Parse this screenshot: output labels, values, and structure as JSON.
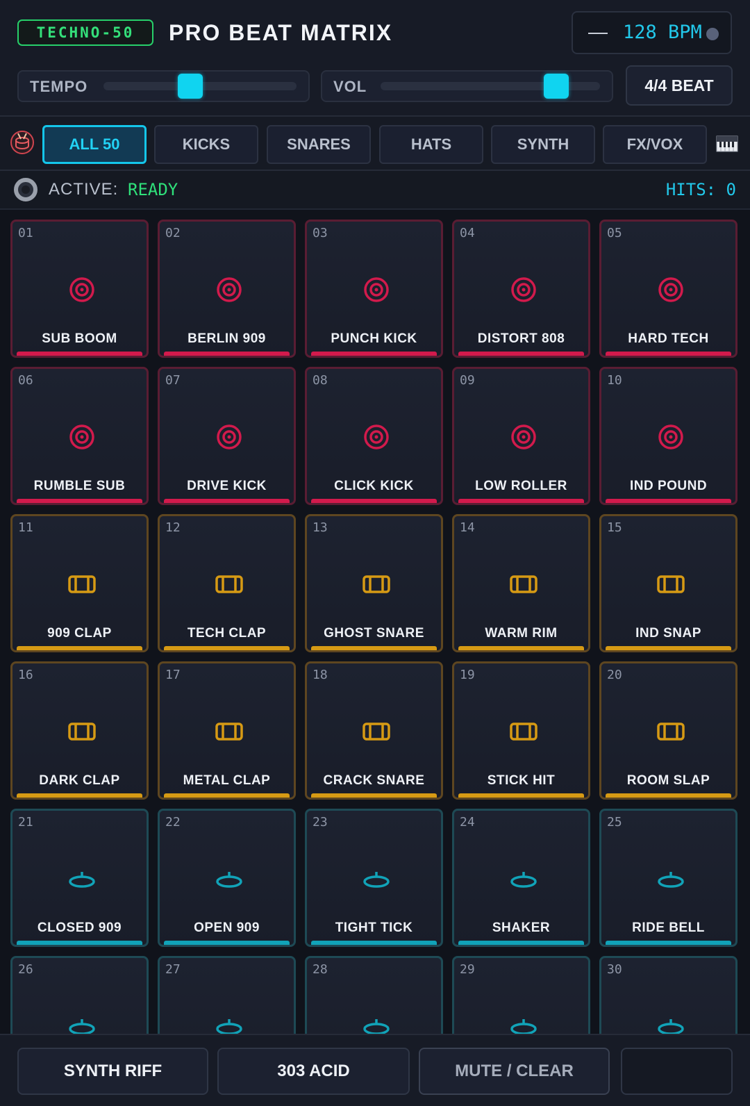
{
  "header": {
    "badge": "TECHNO-50",
    "title": "PRO BEAT MATRIX",
    "bpm": "128 BPM",
    "tempo_label": "TEMPO",
    "vol_label": "VOL",
    "tempo_level": 0.45,
    "vol_level": 0.8,
    "beat_button": "4/4 BEAT"
  },
  "tabs": [
    {
      "label": "ALL 50",
      "active": true
    },
    {
      "label": "KICKS",
      "active": false
    },
    {
      "label": "SNARES",
      "active": false
    },
    {
      "label": "HATS",
      "active": false
    },
    {
      "label": "SYNTH",
      "active": false
    },
    {
      "label": "FX/VOX",
      "active": false
    }
  ],
  "status": {
    "label": "ACTIVE:",
    "value": "READY",
    "hits": "HITS: 0"
  },
  "colors": {
    "kick": "#d21a4c",
    "snare": "#d69a14",
    "hat": "#11a3b8",
    "accent": "#14c6ea",
    "ready": "#2fe07a"
  },
  "pads": [
    {
      "num": "01",
      "label": "SUB BOOM",
      "type": "kick"
    },
    {
      "num": "02",
      "label": "BERLIN 909",
      "type": "kick"
    },
    {
      "num": "03",
      "label": "PUNCH KICK",
      "type": "kick"
    },
    {
      "num": "04",
      "label": "DISTORT 808",
      "type": "kick"
    },
    {
      "num": "05",
      "label": "HARD TECH",
      "type": "kick"
    },
    {
      "num": "06",
      "label": "RUMBLE SUB",
      "type": "kick"
    },
    {
      "num": "07",
      "label": "DRIVE KICK",
      "type": "kick"
    },
    {
      "num": "08",
      "label": "CLICK KICK",
      "type": "kick"
    },
    {
      "num": "09",
      "label": "LOW ROLLER",
      "type": "kick"
    },
    {
      "num": "10",
      "label": "IND POUND",
      "type": "kick"
    },
    {
      "num": "11",
      "label": "909 CLAP",
      "type": "snare"
    },
    {
      "num": "12",
      "label": "TECH CLAP",
      "type": "snare"
    },
    {
      "num": "13",
      "label": "GHOST SNARE",
      "type": "snare"
    },
    {
      "num": "14",
      "label": "WARM RIM",
      "type": "snare"
    },
    {
      "num": "15",
      "label": "IND SNAP",
      "type": "snare"
    },
    {
      "num": "16",
      "label": "DARK CLAP",
      "type": "snare"
    },
    {
      "num": "17",
      "label": "METAL CLAP",
      "type": "snare"
    },
    {
      "num": "18",
      "label": "CRACK SNARE",
      "type": "snare"
    },
    {
      "num": "19",
      "label": "STICK HIT",
      "type": "snare"
    },
    {
      "num": "20",
      "label": "ROOM SLAP",
      "type": "snare"
    },
    {
      "num": "21",
      "label": "CLOSED 909",
      "type": "hat"
    },
    {
      "num": "22",
      "label": "OPEN 909",
      "type": "hat"
    },
    {
      "num": "23",
      "label": "TIGHT TICK",
      "type": "hat"
    },
    {
      "num": "24",
      "label": "SHAKER",
      "type": "hat"
    },
    {
      "num": "25",
      "label": "RIDE BELL",
      "type": "hat"
    },
    {
      "num": "26",
      "label": "",
      "type": "hat"
    },
    {
      "num": "27",
      "label": "",
      "type": "hat"
    },
    {
      "num": "28",
      "label": "",
      "type": "hat"
    },
    {
      "num": "29",
      "label": "",
      "type": "hat"
    },
    {
      "num": "30",
      "label": "",
      "type": "hat"
    }
  ],
  "bottom": {
    "synth_riff": "SYNTH RIFF",
    "acid": "303 ACID",
    "mute_clear": "MUTE / CLEAR",
    "blank": ""
  }
}
